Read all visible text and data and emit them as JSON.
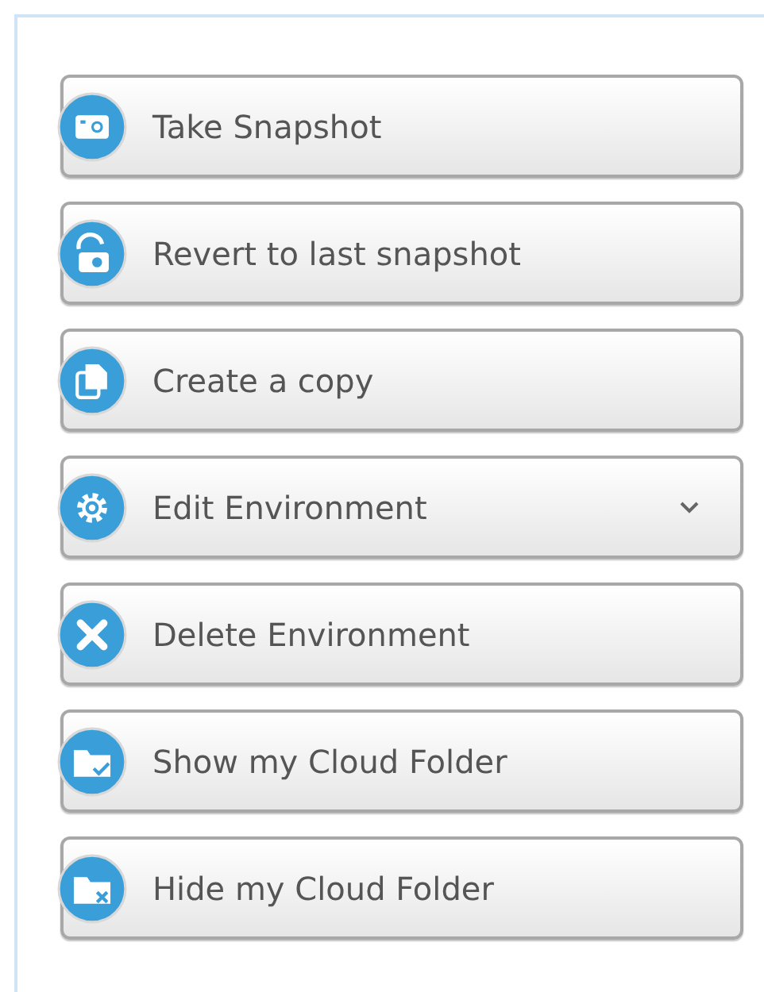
{
  "actions": [
    {
      "label": "Take Snapshot",
      "has_menu": false
    },
    {
      "label": "Revert to last snapshot",
      "has_menu": false
    },
    {
      "label": "Create a copy",
      "has_menu": false
    },
    {
      "label": "Edit Environment",
      "has_menu": true
    },
    {
      "label": "Delete Environment",
      "has_menu": false
    },
    {
      "label": "Show my Cloud Folder",
      "has_menu": false
    },
    {
      "label": "Hide my Cloud Folder",
      "has_menu": false
    }
  ]
}
